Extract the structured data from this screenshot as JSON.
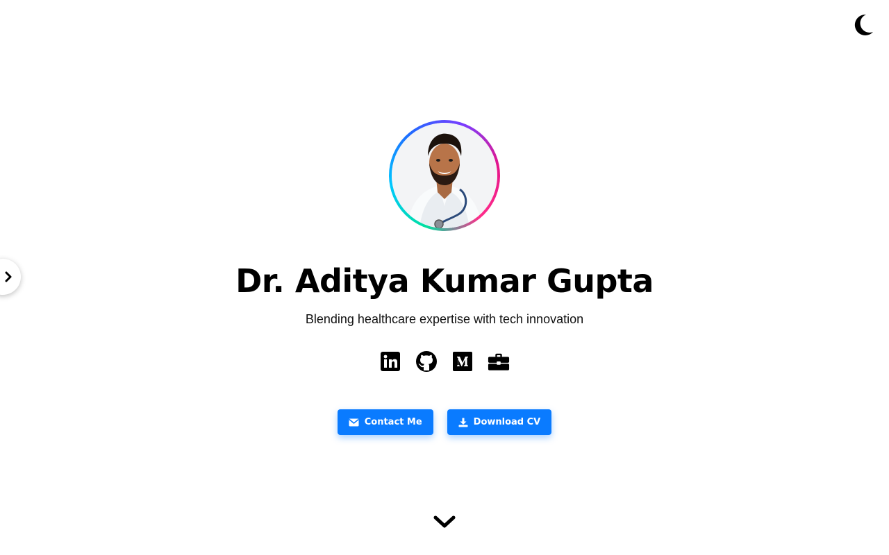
{
  "header": {
    "theme_toggle_icon": "moon-icon"
  },
  "sidebar": {
    "toggle_icon": "chevron-right-icon"
  },
  "profile": {
    "avatar_alt": "Dr. Aditya Kumar Gupta",
    "name": "Dr. Aditya Kumar Gupta",
    "tagline": "Blending healthcare expertise with tech innovation",
    "ring_colors": [
      "#00e0a0",
      "#00c8ff",
      "#1e6bff",
      "#7a3cff",
      "#e6158a"
    ]
  },
  "socials": [
    {
      "name": "linkedin",
      "icon": "linkedin-icon"
    },
    {
      "name": "github",
      "icon": "github-icon"
    },
    {
      "name": "medium",
      "icon": "medium-icon"
    },
    {
      "name": "portfolio",
      "icon": "briefcase-icon"
    }
  ],
  "actions": {
    "contact_label": "Contact Me",
    "contact_icon": "envelope-icon",
    "download_label": "Download CV",
    "download_icon": "download-icon",
    "accent": "#0a7bff"
  },
  "scroll": {
    "icon": "chevron-down-icon"
  }
}
